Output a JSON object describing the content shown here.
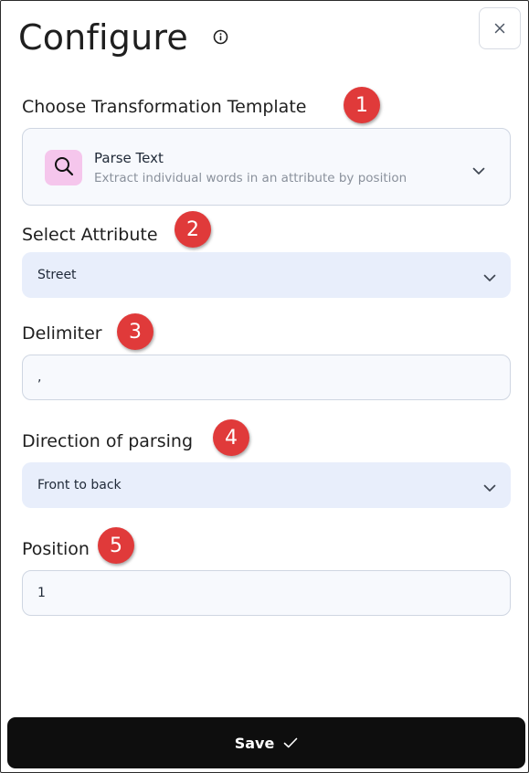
{
  "header": {
    "title": "Configure",
    "info_icon": "info-icon",
    "close_icon": "close-icon"
  },
  "sections": {
    "template": {
      "label": "Choose Transformation Template",
      "step": "1",
      "selected_name": "Parse Text",
      "selected_description": "Extract individual words in an attribute by position",
      "icon": "search-icon"
    },
    "attribute": {
      "label": "Select Attribute",
      "step": "2",
      "value": "Street"
    },
    "delimiter": {
      "label": "Delimiter",
      "step": "3",
      "value": ","
    },
    "direction": {
      "label": "Direction of parsing",
      "step": "4",
      "value": "Front to back"
    },
    "position": {
      "label": "Position",
      "step": "5",
      "value": "1"
    }
  },
  "footer": {
    "save_label": "Save",
    "save_icon": "checkmark-icon"
  },
  "colors": {
    "badge": "#e03a3a",
    "select_bg": "#e8eefb",
    "template_icon_bg": "#f5c6ec",
    "save_bg": "#0e0e0e"
  }
}
